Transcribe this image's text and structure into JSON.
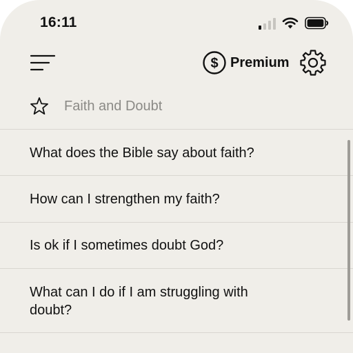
{
  "status_bar": {
    "time": "16:11"
  },
  "header": {
    "menu_icon": "hamburger-menu-icon",
    "premium_icon": "dollar-circle-icon",
    "premium_label": "Premium",
    "settings_icon": "gear-icon"
  },
  "category": {
    "star_icon": "star-outline-icon",
    "title": "Faith and Doubt"
  },
  "questions": [
    {
      "text": "What does the Bible say about faith?"
    },
    {
      "text": "How can I strengthen my faith?"
    },
    {
      "text": "Is ok if I sometimes doubt God?"
    },
    {
      "text": "What can I do if I am struggling with doubt?"
    }
  ],
  "colors": {
    "background": "#f0eee9",
    "text": "#111111",
    "muted_text": "#8b8a86",
    "divider": "#d9d6d0"
  }
}
